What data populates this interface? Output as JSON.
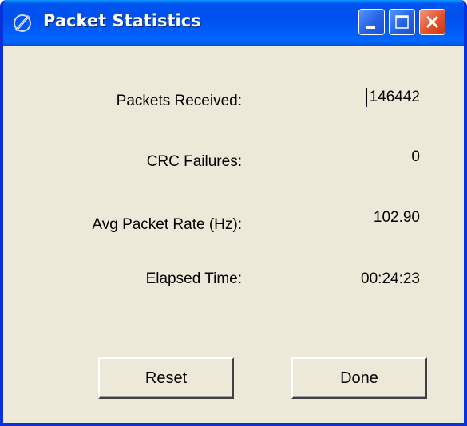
{
  "window": {
    "title": "Packet Statistics",
    "icon": "app-icon"
  },
  "stats": [
    {
      "label": "Packets Received:",
      "value": "146442"
    },
    {
      "label": "CRC Failures:",
      "value": "0"
    },
    {
      "label": "Avg Packet Rate (Hz):",
      "value": "102.90"
    },
    {
      "label": "Elapsed Time:",
      "value": "00:24:23"
    }
  ],
  "buttons": {
    "reset": "Reset",
    "done": "Done"
  },
  "colors": {
    "titlebar": "#0054e3",
    "window_bg": "#ece9d8",
    "close": "#e2532c"
  }
}
